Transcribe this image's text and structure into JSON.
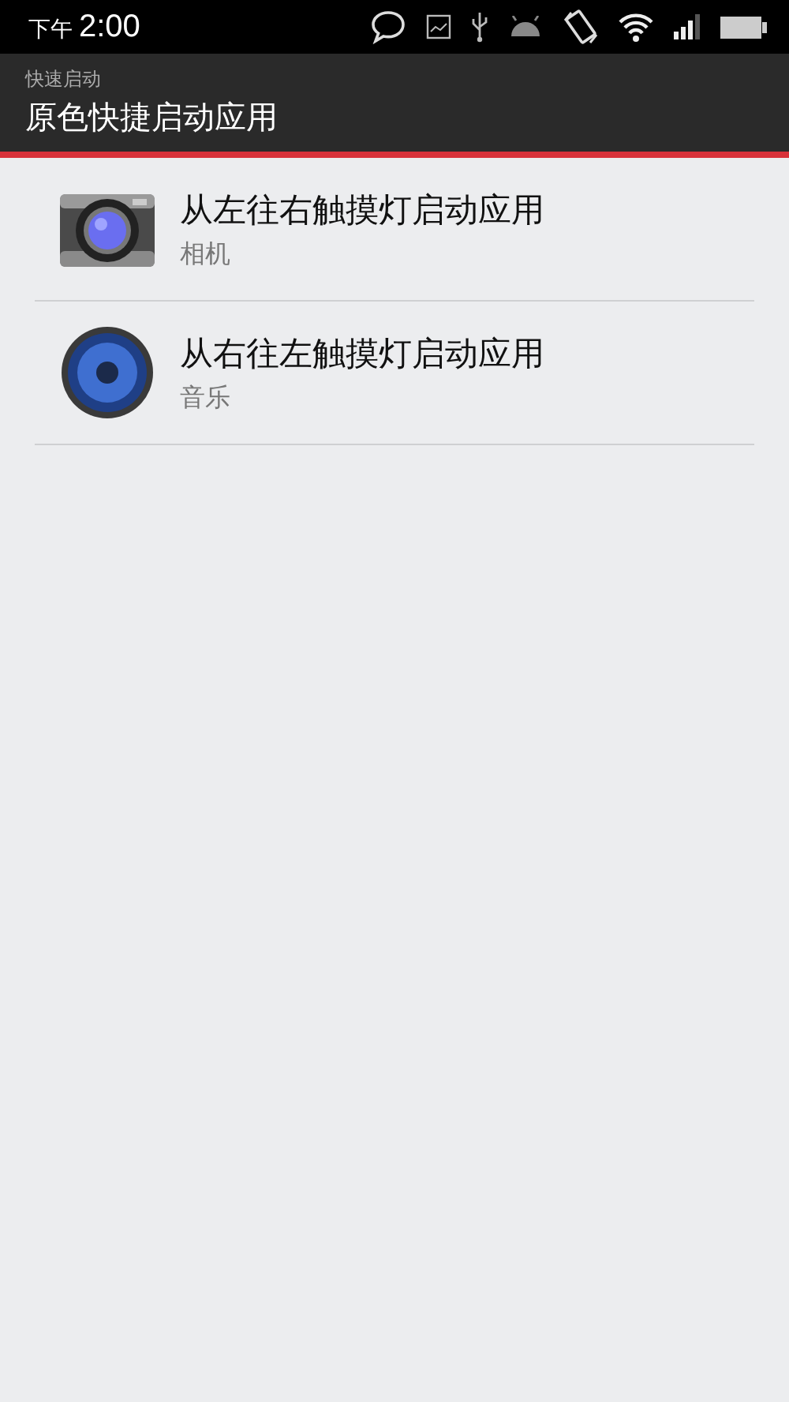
{
  "status_bar": {
    "period": "下午",
    "time": "2:00"
  },
  "header": {
    "subtitle": "快速启动",
    "title": "原色快捷启动应用"
  },
  "items": [
    {
      "kind": "camera",
      "title": "从左往右触摸灯启动应用",
      "subtitle": "相机"
    },
    {
      "kind": "speaker",
      "title": "从右往左触摸灯启动应用",
      "subtitle": "音乐"
    }
  ]
}
